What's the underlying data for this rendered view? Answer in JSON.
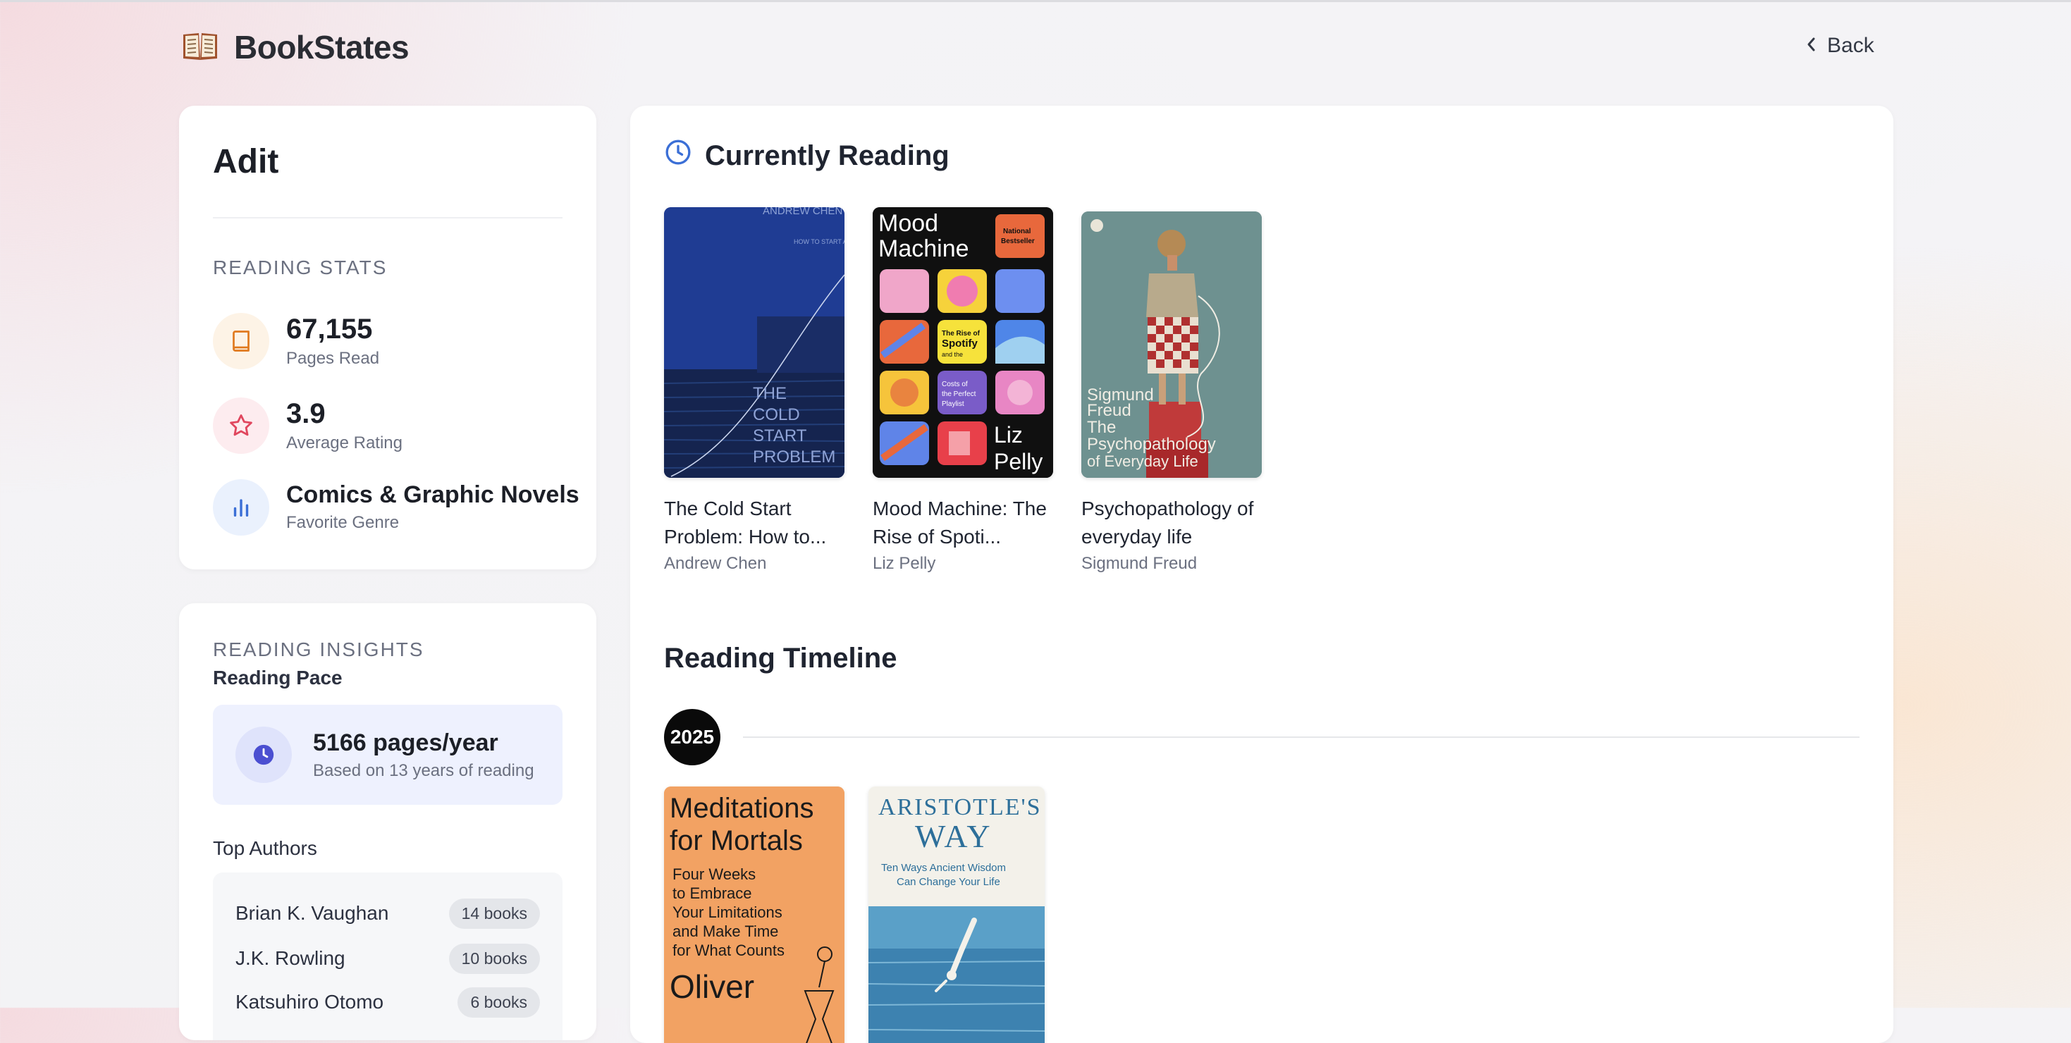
{
  "header": {
    "brand": "BookStates",
    "back_label": "Back"
  },
  "profile": {
    "name": "Adit",
    "stats_heading": "READING STATS",
    "stats": [
      {
        "value": "67,155",
        "label": "Pages Read",
        "icon": "book-icon",
        "color": "#e07a1f",
        "bg": "#fdf3e6"
      },
      {
        "value": "3.9",
        "label": "Average Rating",
        "icon": "star-icon",
        "color": "#e0475e",
        "bg": "#fdecef"
      },
      {
        "value": "Comics & Graphic Novels",
        "label": "Favorite Genre",
        "icon": "bar-chart-icon",
        "color": "#3b6fd6",
        "bg": "#eaf1fd"
      }
    ]
  },
  "insights": {
    "heading": "READING INSIGHTS",
    "pace_heading": "Reading Pace",
    "pace_value": "5166 pages/year",
    "pace_note": "Based on 13 years of reading",
    "authors_heading": "Top Authors",
    "authors": [
      {
        "name": "Brian K. Vaughan",
        "count": "14 books"
      },
      {
        "name": "J.K. Rowling",
        "count": "10 books"
      },
      {
        "name": "Katsuhiro Otomo",
        "count": "6 books"
      }
    ]
  },
  "currently_reading": {
    "heading": "Currently Reading",
    "books": [
      {
        "title": "The Cold Start Problem: How to...",
        "author": "Andrew Chen",
        "cover_author": "ANDREW CHEN",
        "cover_tagline": "HOW TO START AND SCALE NETWORK EFFECTS",
        "cover_title_lines": [
          "THE",
          "COLD",
          "START",
          "PROBLEM"
        ]
      },
      {
        "title": "Mood Machine: The Rise of Spoti...",
        "author": "Liz Pelly",
        "cover_title_lines": [
          "Mood",
          "Machine"
        ],
        "cover_badge_lines": [
          "National",
          "Bestseller"
        ],
        "cover_tile_a_lines": [
          "The Rise of",
          "Spotify",
          "and the"
        ],
        "cover_tile_b_lines": [
          "Costs of",
          "the Perfect",
          "Playlist"
        ],
        "cover_author_lines": [
          "Liz",
          "Pelly"
        ]
      },
      {
        "title": "Psychopathology of everyday life",
        "author": "Sigmund Freud",
        "cover_author_lines": [
          "Sigmund",
          "Freud"
        ],
        "cover_title_lines": [
          "The",
          "Psychopathology",
          "of Everyday Life"
        ]
      }
    ]
  },
  "timeline": {
    "heading": "Reading Timeline",
    "year": "2025",
    "books": [
      {
        "cover_title_lines": [
          "Meditations",
          "for Mortals"
        ],
        "cover_sub_lines": [
          "Four Weeks",
          "to Embrace",
          "Your Limitations",
          "and Make Time",
          "for What Counts"
        ],
        "cover_author": "Oliver"
      },
      {
        "cover_title_lines": [
          "ARISTOTLE'S",
          "WAY"
        ],
        "cover_sub_lines": [
          "Ten Ways Ancient Wisdom",
          "Can Change Your Life"
        ]
      }
    ]
  }
}
